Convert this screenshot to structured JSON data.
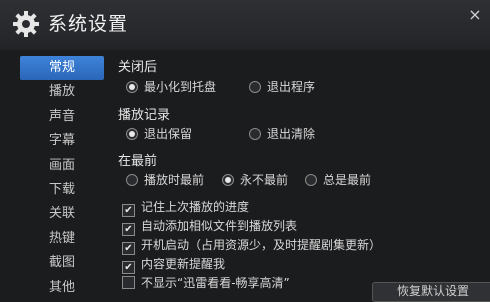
{
  "window": {
    "title": "系统设置",
    "close_glyph": "×"
  },
  "sidebar": {
    "items": [
      {
        "label": "常规",
        "active": true
      },
      {
        "label": "播放",
        "active": false
      },
      {
        "label": "声音",
        "active": false
      },
      {
        "label": "字幕",
        "active": false
      },
      {
        "label": "画面",
        "active": false
      },
      {
        "label": "下载",
        "active": false
      },
      {
        "label": "关联",
        "active": false
      },
      {
        "label": "热键",
        "active": false
      },
      {
        "label": "截图",
        "active": false
      },
      {
        "label": "其他",
        "active": false
      }
    ]
  },
  "sections": {
    "close": {
      "title": "关闭后",
      "options": [
        {
          "label": "最小化到托盘",
          "selected": true
        },
        {
          "label": "退出程序",
          "selected": false
        }
      ]
    },
    "history": {
      "title": "播放记录",
      "options": [
        {
          "label": "退出保留",
          "selected": true
        },
        {
          "label": "退出清除",
          "selected": false
        }
      ]
    },
    "top": {
      "title": "在最前",
      "options": [
        {
          "label": "播放时最前",
          "selected": false
        },
        {
          "label": "永不最前",
          "selected": true
        },
        {
          "label": "总是最前",
          "selected": false
        }
      ]
    }
  },
  "checkboxes": [
    {
      "label": "记住上次播放的进度",
      "checked": true
    },
    {
      "label": "自动添加相似文件到播放列表",
      "checked": true
    },
    {
      "label": "开机启动（占用资源少，及时提醒剧集更新）",
      "checked": true
    },
    {
      "label": "内容更新提醒我",
      "checked": true
    },
    {
      "label": "不显示“迅雷看看-畅享高清”",
      "checked": false
    }
  ],
  "footer": {
    "button_label": "恢复默认设置"
  },
  "colors": {
    "accent": "#2f6fc7",
    "background": "#1b1c1e"
  }
}
